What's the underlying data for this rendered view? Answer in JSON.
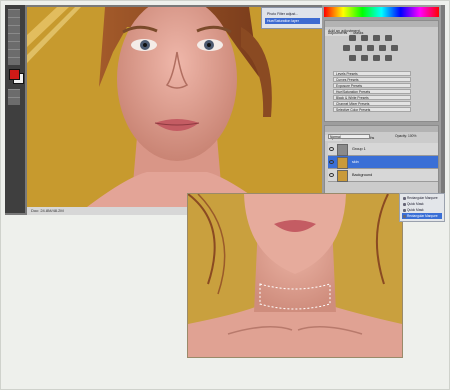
{
  "app": {
    "status_text": "Doc: 24.8M/48.2M"
  },
  "navigator_popup": {
    "items": [
      "Photo Filter adjust...",
      "Hue/Saturation layer"
    ]
  },
  "adjustments_panel": {
    "tabs": [
      "Adjustments",
      "Masks"
    ],
    "title": "Add an adjustment",
    "presets": [
      "Levels Presets",
      "Curves Presets",
      "Exposure Presets",
      "Hue/Saturation Presets",
      "Black & White Presets",
      "Channel Mixer Presets",
      "Selective Color Presets"
    ]
  },
  "layers_panel": {
    "tabs": [
      "Layers",
      "Channels",
      "Paths"
    ],
    "blend_mode": "Normal",
    "opacity_label": "Opacity: 100%",
    "layers": [
      {
        "name": "Group 1",
        "selected": false
      },
      {
        "name": "skin",
        "selected": true
      },
      {
        "name": "Background",
        "selected": false
      }
    ]
  },
  "history_panel": {
    "items": [
      "Rectangular Marquee",
      "Quick Mask",
      "Quick Mask",
      "Rectangular Marquee"
    ]
  },
  "colors": {
    "backdrop": "#c8a038",
    "skin": "#e0a79c",
    "accent": "#3a6fd6",
    "foreground_swatch": "#d11a17"
  }
}
